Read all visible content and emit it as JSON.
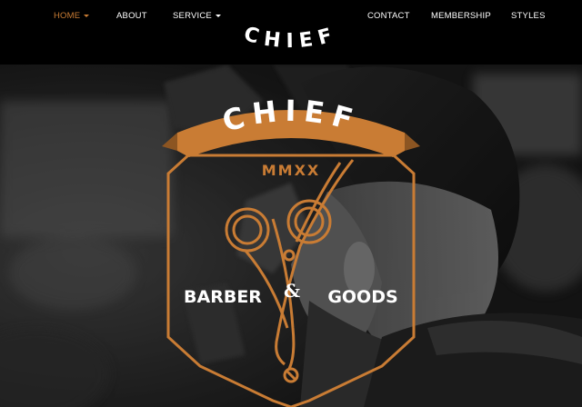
{
  "nav": {
    "home": "HOME",
    "about": "ABOUT",
    "service": "SERVICE",
    "contact": "CONTACT",
    "membership": "MEMBERSHIP",
    "styles": "STYLES",
    "brand": "CHIEF"
  },
  "badge": {
    "title": "CHIEF",
    "year": "MMXX",
    "left_word": "BARBER",
    "ampersand": "&",
    "right_word": "GOODS"
  },
  "colors": {
    "accent": "#c97c34",
    "nav_bg": "#000000"
  }
}
